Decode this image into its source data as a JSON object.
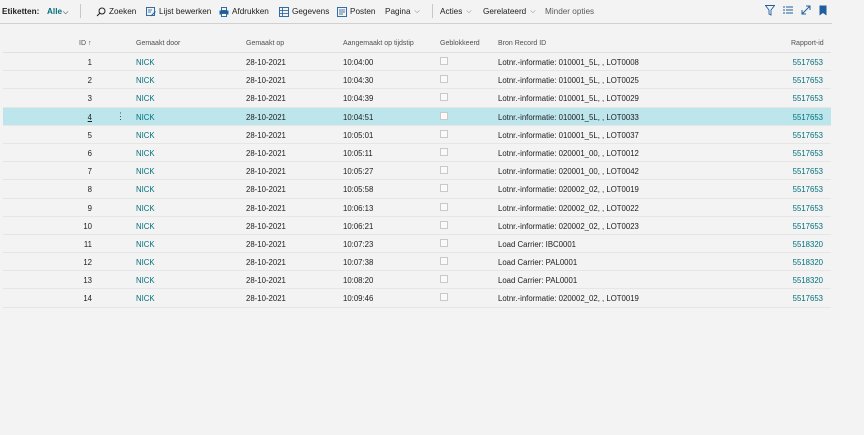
{
  "toolbar": {
    "labels_caption": "Etiketten:",
    "filter": "Alle",
    "search": "Zoeken",
    "edit_list": "Lijst bewerken",
    "print": "Afdrukken",
    "data": "Gegevens",
    "entries": "Posten",
    "page": "Pagina",
    "actions": "Acties",
    "related": "Gerelateerd",
    "fewer_options": "Minder opties"
  },
  "table": {
    "headers": {
      "id": "ID",
      "id_sort": "↑",
      "created_by": "Gemaakt door",
      "created_on": "Gemaakt op",
      "created_time": "Aangemaakt op tijdstip",
      "blocked": "Geblokkeerd",
      "source_id": "Bron Record ID",
      "report_id": "Rapport-id"
    },
    "rows": [
      {
        "id": "1",
        "by": "NICK",
        "date": "28-10-2021",
        "time": "10:04:00",
        "source": "Lotnr.-informatie: 010001_5L, , LOT0008",
        "report": "5517653"
      },
      {
        "id": "2",
        "by": "NICK",
        "date": "28-10-2021",
        "time": "10:04:30",
        "source": "Lotnr.-informatie: 010001_5L, , LOT0025",
        "report": "5517653"
      },
      {
        "id": "3",
        "by": "NICK",
        "date": "28-10-2021",
        "time": "10:04:39",
        "source": "Lotnr.-informatie: 010001_5L, , LOT0029",
        "report": "5517653"
      },
      {
        "id": "4",
        "by": "NICK",
        "date": "28-10-2021",
        "time": "10:04:51",
        "source": "Lotnr.-informatie: 010001_5L, , LOT0033",
        "report": "5517653"
      },
      {
        "id": "5",
        "by": "NICK",
        "date": "28-10-2021",
        "time": "10:05:01",
        "source": "Lotnr.-informatie: 010001_5L, , LOT0037",
        "report": "5517653"
      },
      {
        "id": "6",
        "by": "NICK",
        "date": "28-10-2021",
        "time": "10:05:11",
        "source": "Lotnr.-informatie: 020001_00, , LOT0012",
        "report": "5517653"
      },
      {
        "id": "7",
        "by": "NICK",
        "date": "28-10-2021",
        "time": "10:05:27",
        "source": "Lotnr.-informatie: 020001_00, , LOT0042",
        "report": "5517653"
      },
      {
        "id": "8",
        "by": "NICK",
        "date": "28-10-2021",
        "time": "10:05:58",
        "source": "Lotnr.-informatie: 020002_02, , LOT0019",
        "report": "5517653"
      },
      {
        "id": "9",
        "by": "NICK",
        "date": "28-10-2021",
        "time": "10:06:13",
        "source": "Lotnr.-informatie: 020002_02, , LOT0022",
        "report": "5517653"
      },
      {
        "id": "10",
        "by": "NICK",
        "date": "28-10-2021",
        "time": "10:06:21",
        "source": "Lotnr.-informatie: 020002_02, , LOT0023",
        "report": "5517653"
      },
      {
        "id": "11",
        "by": "NICK",
        "date": "28-10-2021",
        "time": "10:07:23",
        "source": "Load Carrier: IBC0001",
        "report": "5518320"
      },
      {
        "id": "12",
        "by": "NICK",
        "date": "28-10-2021",
        "time": "10:07:38",
        "source": "Load Carrier: PAL0001",
        "report": "5518320"
      },
      {
        "id": "13",
        "by": "NICK",
        "date": "28-10-2021",
        "time": "10:08:20",
        "source": "Load Carrier: PAL0001",
        "report": "5518320"
      },
      {
        "id": "14",
        "by": "NICK",
        "date": "28-10-2021",
        "time": "10:09:46",
        "source": "Lotnr.-informatie: 020002_02, , LOT0019",
        "report": "5517653"
      }
    ],
    "selected_row": "4",
    "row_menu_glyph": "⋮"
  },
  "colors": {
    "accent": "#00707a",
    "selected_row": "#bde6ec",
    "background": "#f3f3f4"
  },
  "icons": [
    "search-icon",
    "edit-list-icon",
    "print-icon",
    "data-icon",
    "entries-icon",
    "filter-icon",
    "list-view-icon",
    "expand-icon",
    "bookmark-icon"
  ]
}
